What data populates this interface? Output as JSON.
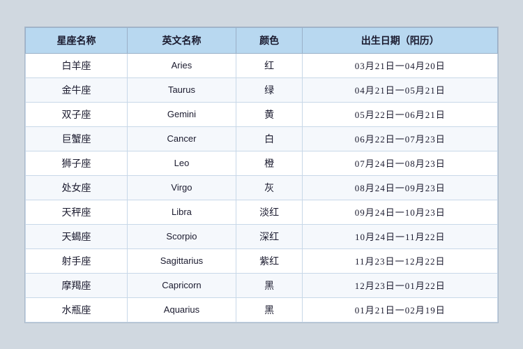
{
  "table": {
    "headers": [
      "星座名称",
      "英文名称",
      "颜色",
      "出生日期（阳历）"
    ],
    "rows": [
      {
        "zh_name": "白羊座",
        "en_name": "Aries",
        "color": "红",
        "date_range": "03月21日一04月20日"
      },
      {
        "zh_name": "金牛座",
        "en_name": "Taurus",
        "color": "绿",
        "date_range": "04月21日一05月21日"
      },
      {
        "zh_name": "双子座",
        "en_name": "Gemini",
        "color": "黄",
        "date_range": "05月22日一06月21日"
      },
      {
        "zh_name": "巨蟹座",
        "en_name": "Cancer",
        "color": "白",
        "date_range": "06月22日一07月23日"
      },
      {
        "zh_name": "狮子座",
        "en_name": "Leo",
        "color": "橙",
        "date_range": "07月24日一08月23日"
      },
      {
        "zh_name": "处女座",
        "en_name": "Virgo",
        "color": "灰",
        "date_range": "08月24日一09月23日"
      },
      {
        "zh_name": "天秤座",
        "en_name": "Libra",
        "color": "淡红",
        "date_range": "09月24日一10月23日"
      },
      {
        "zh_name": "天蝎座",
        "en_name": "Scorpio",
        "color": "深红",
        "date_range": "10月24日一11月22日"
      },
      {
        "zh_name": "射手座",
        "en_name": "Sagittarius",
        "color": "紫红",
        "date_range": "11月23日一12月22日"
      },
      {
        "zh_name": "摩羯座",
        "en_name": "Capricorn",
        "color": "黑",
        "date_range": "12月23日一01月22日"
      },
      {
        "zh_name": "水瓶座",
        "en_name": "Aquarius",
        "color": "黑",
        "date_range": "01月21日一02月19日"
      }
    ]
  }
}
